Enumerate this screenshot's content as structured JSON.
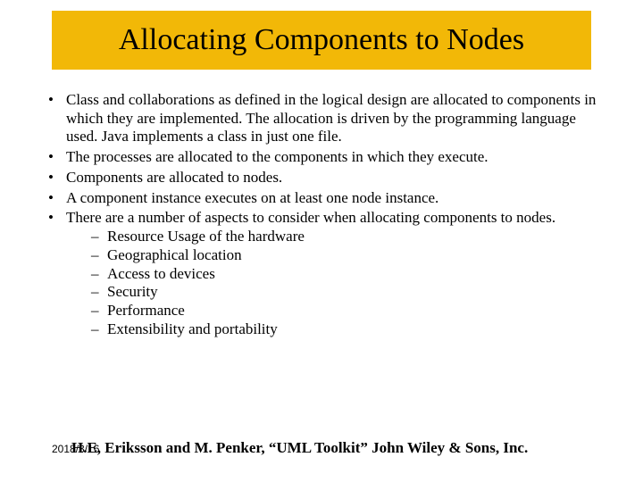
{
  "title": "Allocating Components to Nodes",
  "bullets": [
    "Class and collaborations as defined in the logical design are allocated to components in which they are implemented. The allocation is driven by the programming language used. Java implements a class in just one file.",
    "The processes are allocated to the components in which they execute.",
    "Components are allocated to nodes.",
    "A component instance executes on at least one node instance.",
    "There are a number of aspects to consider when allocating components to nodes."
  ],
  "sub_bullets": [
    "Resource Usage of the hardware",
    "Geographical location",
    "Access to devices",
    "Security",
    "Performance",
    "Extensibility and portability"
  ],
  "footer_date": "2018/3/16",
  "footer_reference": "H.E, Eriksson and M. Penker, “UML Toolkit” John Wiley & Sons, Inc."
}
